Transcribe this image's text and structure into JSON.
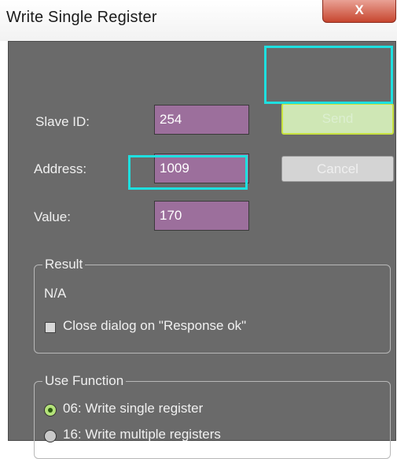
{
  "window": {
    "title": "Write Single Register",
    "close_label": "X"
  },
  "form": {
    "slave_id_label": "Slave ID:",
    "slave_id_value": "254",
    "address_label": "Address:",
    "address_value": "1009",
    "value_label": "Value:",
    "value_value": "170"
  },
  "buttons": {
    "send_label": "Send",
    "cancel_label": "Cancel"
  },
  "result": {
    "group_label": "Result",
    "text": "N/A",
    "close_dialog_label": "Close dialog on \"Response ok\"",
    "close_dialog_checked": false
  },
  "use_function": {
    "group_label": "Use Function",
    "options": [
      {
        "label": "06: Write single register",
        "selected": true
      },
      {
        "label": "16: Write multiple registers",
        "selected": false
      }
    ]
  }
}
